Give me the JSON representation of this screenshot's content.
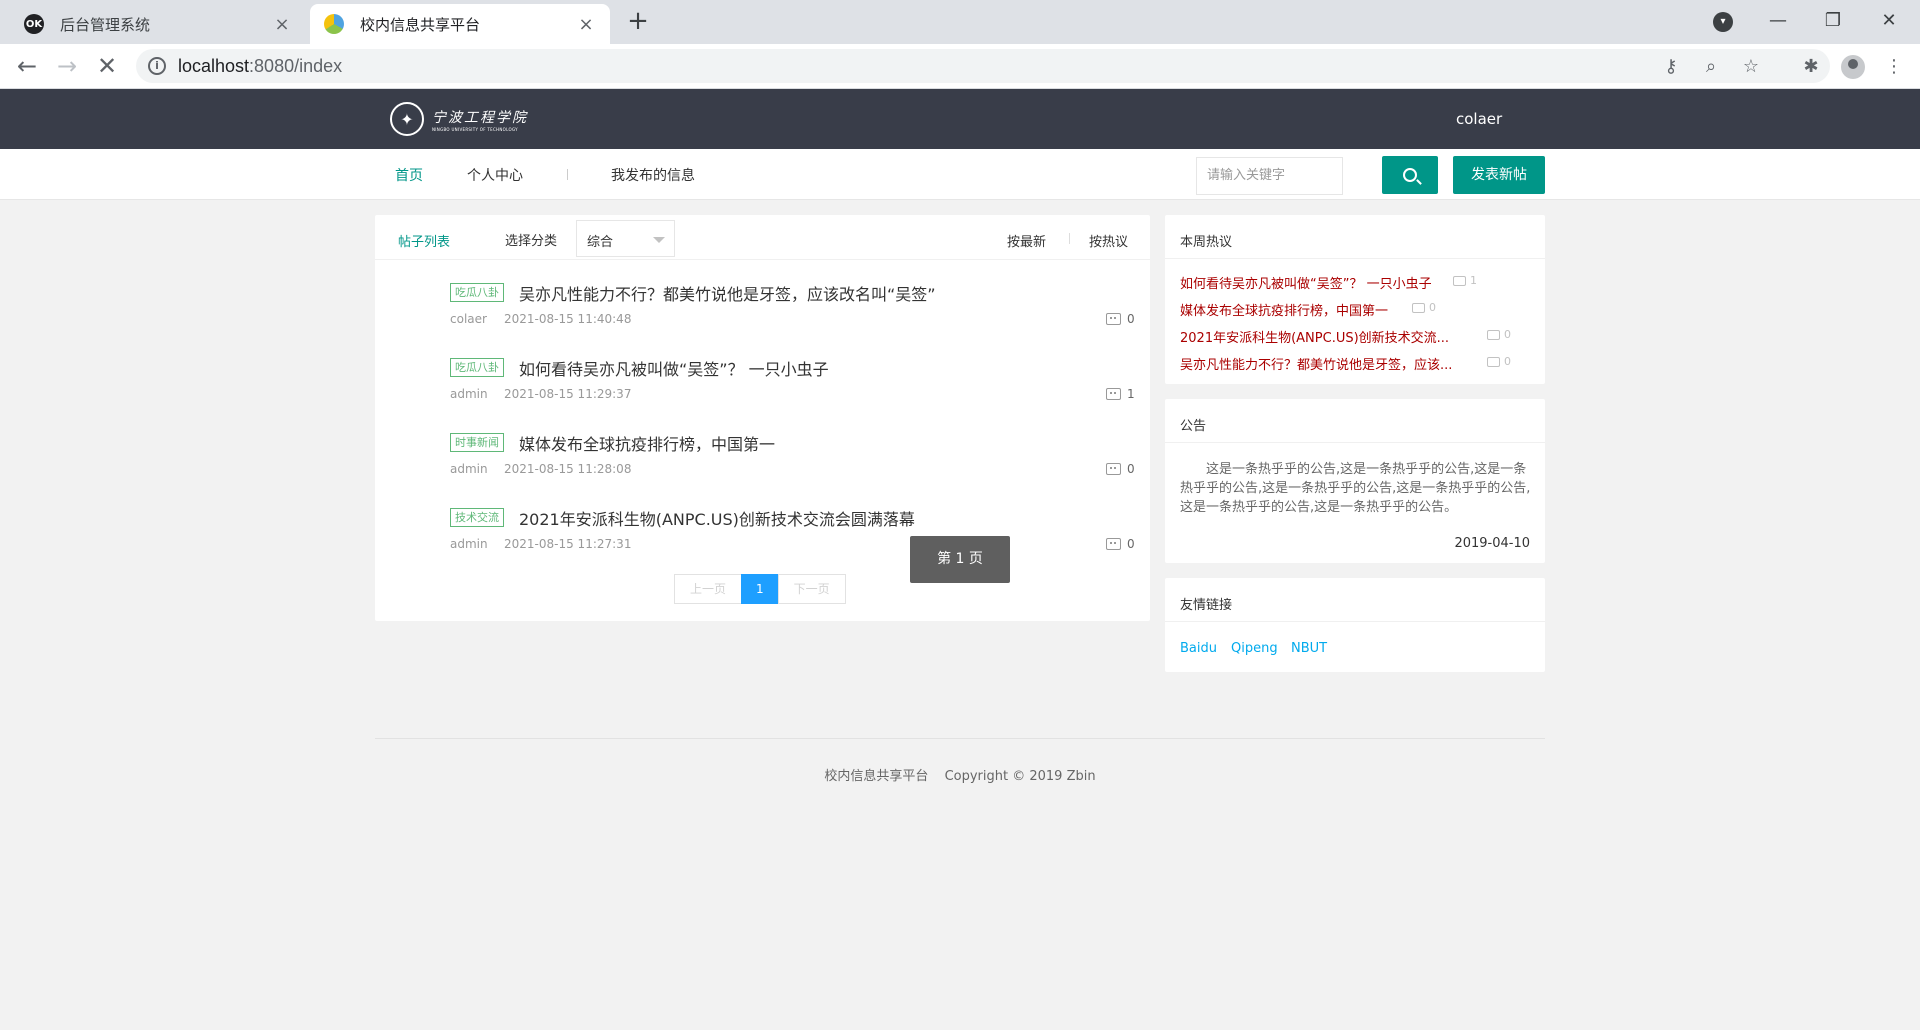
{
  "browser": {
    "tabs": [
      {
        "title": "后台管理系统",
        "favicon": "ok-icon",
        "active": false
      },
      {
        "title": "校内信息共享平台",
        "favicon": "school-favicon-icon",
        "active": true
      }
    ],
    "url_host": "localhost",
    "url_rest": ":8080/index"
  },
  "header": {
    "logo_cn": "宁波工程学院",
    "logo_en": "NINGBO UNIVERSITY OF TECHNOLOGY",
    "username": "colaer"
  },
  "nav": {
    "items": [
      {
        "label": "首页",
        "active": true
      },
      {
        "label": "个人中心",
        "active": false
      },
      {
        "label": "我发布的信息",
        "active": false
      }
    ],
    "search_placeholder": "请输入关键字",
    "post_button": "发表新帖"
  },
  "main": {
    "list_title": "帖子列表",
    "category_label": "选择分类",
    "category_value": "综合",
    "sort_latest": "按最新",
    "sort_hot": "按热议",
    "posts": [
      {
        "tag": "吃瓜八卦",
        "title": "吴亦凡性能力不行？都美竹说他是牙签，应该改名叫“吴签”",
        "author": "colaer",
        "time": "2021-08-15 11:40:48",
        "comments": "0"
      },
      {
        "tag": "吃瓜八卦",
        "title": "如何看待吴亦凡被叫做“吴签”？ 一只小虫子",
        "author": "admin",
        "time": "2021-08-15 11:29:37",
        "comments": "1"
      },
      {
        "tag": "时事新闻",
        "title": "媒体发布全球抗疫排行榜，中国第一",
        "author": "admin",
        "time": "2021-08-15 11:28:08",
        "comments": "0"
      },
      {
        "tag": "技术交流",
        "title": "2021年安派科生物(ANPC.US)创新技术交流会圆满落幕",
        "author": "admin",
        "time": "2021-08-15 11:27:31",
        "comments": "0"
      }
    ],
    "pager": {
      "prev": "上一页",
      "current": "1",
      "next": "下一页"
    },
    "toast": "第 1 页"
  },
  "sidebar": {
    "hot_title": "本周热议",
    "hot_items": [
      {
        "title": "如何看待吴亦凡被叫做“吴签”？ 一只小虫子",
        "comments": "1"
      },
      {
        "title": "媒体发布全球抗疫排行榜，中国第一",
        "comments": "0"
      },
      {
        "title": "2021年安派科生物(ANPC.US)创新技术交流...",
        "comments": "0"
      },
      {
        "title": "吴亦凡性能力不行？都美竹说他是牙签，应该...",
        "comments": "0"
      }
    ],
    "notice_title": "公告",
    "notice_text": "这是一条热乎乎的公告,这是一条热乎乎的公告,这是一条热乎乎的公告,这是一条热乎乎的公告,这是一条热乎乎的公告,这是一条热乎乎的公告,这是一条热乎乎的公告。",
    "notice_date": "2019-04-10",
    "links_title": "友情链接",
    "links": [
      "Baidu",
      "Qipeng",
      "NBUT"
    ]
  },
  "footer": {
    "site_name": "校内信息共享平台",
    "copyright": "Copyright  © 2019 Zbin"
  },
  "colors": {
    "header_bg": "#393d49",
    "accent": "#009688",
    "tag_green": "#5fb878",
    "hot_red": "#aa0000",
    "link_blue": "#01aaed",
    "page_current": "#1e9fff"
  }
}
